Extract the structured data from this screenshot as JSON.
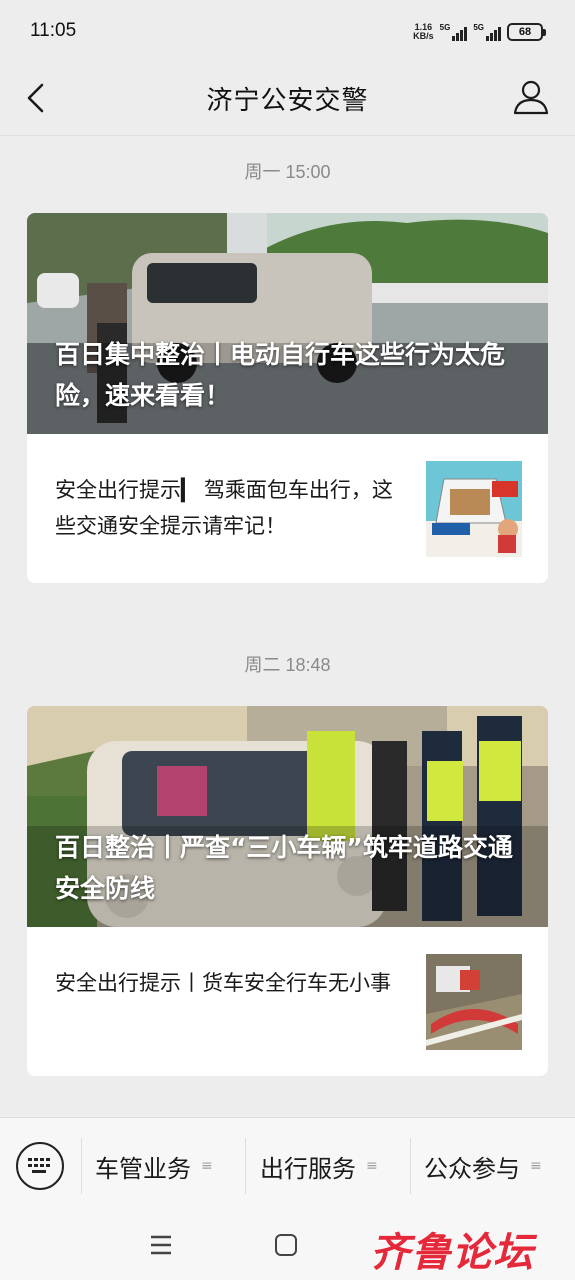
{
  "status_bar": {
    "time": "11:05",
    "net_speed_value": "1.16",
    "net_speed_unit": "KB/s",
    "signal_label_1": "5G",
    "signal_label_2": "5G",
    "battery": "68"
  },
  "header": {
    "title": "济宁公安交警",
    "back_icon": "chevron-left-icon",
    "profile_icon": "person-icon"
  },
  "feed": [
    {
      "timestamp": "周一 15:00",
      "cover_title": "百日集中整治丨电动自行车这些行为太危险，速来看看！",
      "sub_title": "安全出行提示▎ 驾乘面包车出行，这些交通安全提示请牢记！"
    },
    {
      "timestamp": "周二 18:48",
      "cover_title": "百日整治丨严查“三小车辆”筑牢道路交通安全防线",
      "sub_title": "安全出行提示丨货车安全行车无小事"
    }
  ],
  "bottom_menu": {
    "keyboard_icon": "keyboard-icon",
    "items": [
      {
        "label": "车管业务",
        "icon": "≡"
      },
      {
        "label": "出行服务",
        "icon": "≡"
      },
      {
        "label": "公众参与",
        "icon": "≡"
      }
    ]
  },
  "nav_bar": {
    "menu_icon": "menu-icon",
    "home_icon": "home-square-icon"
  },
  "watermark": "齐鲁论坛",
  "colors": {
    "background": "#ededed",
    "card": "#ffffff",
    "watermark": "#e5293a"
  }
}
